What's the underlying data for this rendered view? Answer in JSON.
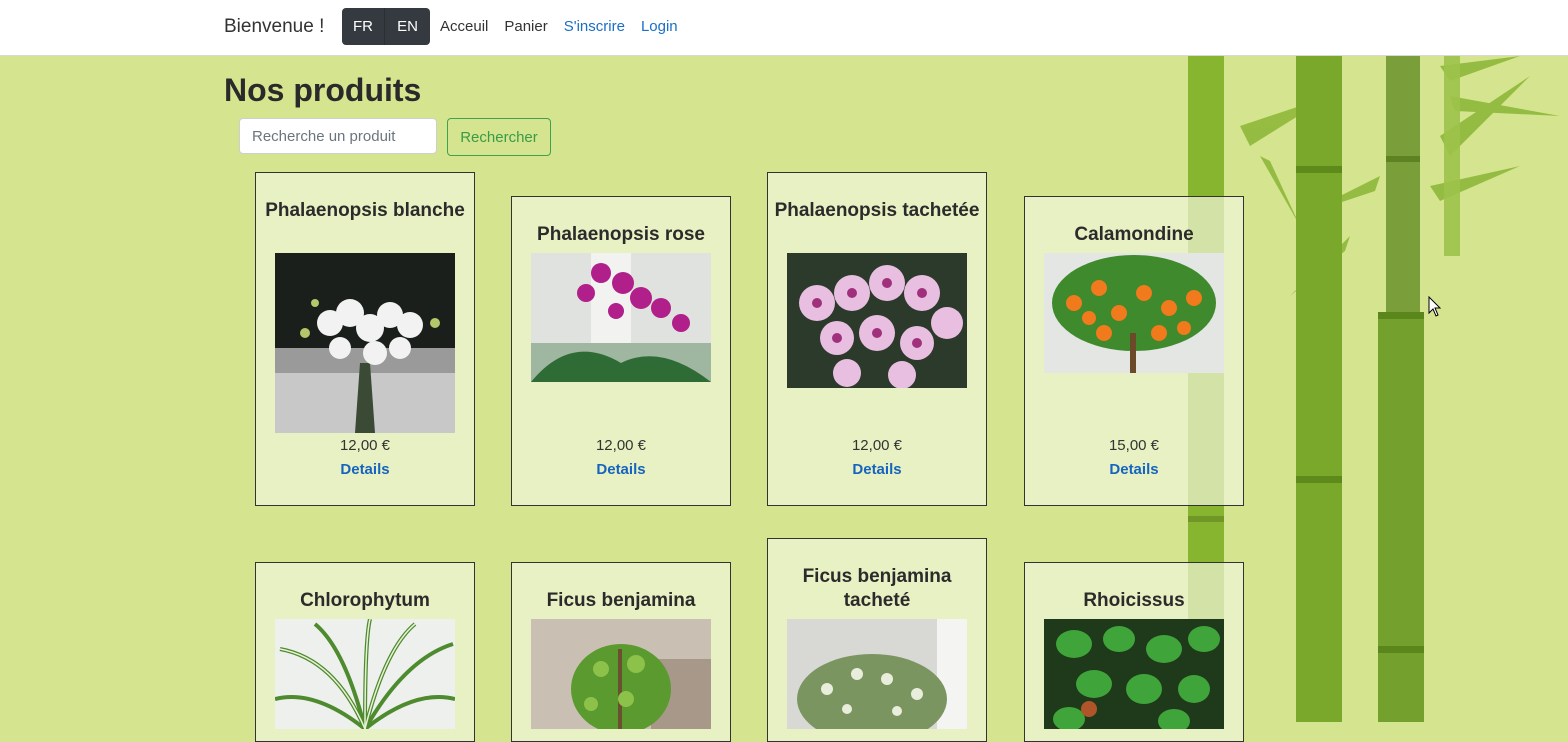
{
  "navbar": {
    "brand": "Bienvenue !",
    "lang_fr": "FR",
    "lang_en": "EN",
    "links": [
      "Acceuil",
      "Panier",
      "S'inscrire",
      "Login"
    ]
  },
  "main": {
    "title": "Nos produits",
    "search_placeholder": "Recherche un produit",
    "search_button": "Rechercher"
  },
  "products": [
    {
      "name": "Phalaenopsis blanche",
      "price": "12,00 €",
      "link": "Details"
    },
    {
      "name": "Phalaenopsis rose",
      "price": "12,00 €",
      "link": "Details"
    },
    {
      "name": "Phalaenopsis tachetée",
      "price": "12,00 €",
      "link": "Details"
    },
    {
      "name": "Calamondine",
      "price": "15,00 €",
      "link": "Details"
    },
    {
      "name": "Chlorophytum"
    },
    {
      "name": "Ficus benjamina"
    },
    {
      "name": "Ficus benjamina tacheté"
    },
    {
      "name": "Rhoicissus"
    }
  ],
  "colors": {
    "background": "#d5e58f",
    "accent_green": "#3fa34d",
    "link_blue": "#1565c0",
    "lang_button": "#343a40"
  }
}
